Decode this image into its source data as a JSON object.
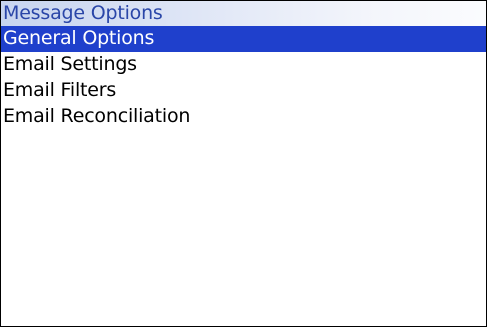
{
  "title": "Message Options",
  "menu": {
    "items": [
      {
        "label": "General Options",
        "selected": true
      },
      {
        "label": "Email Settings",
        "selected": false
      },
      {
        "label": "Email Filters",
        "selected": false
      },
      {
        "label": "Email Reconciliation",
        "selected": false
      }
    ]
  },
  "colors": {
    "title_text": "#2a46a8",
    "title_bar_gradient_start": "#c7d4ef",
    "selection_background": "#1f40cc",
    "selection_text": "#ffffff",
    "item_text": "#000000"
  }
}
